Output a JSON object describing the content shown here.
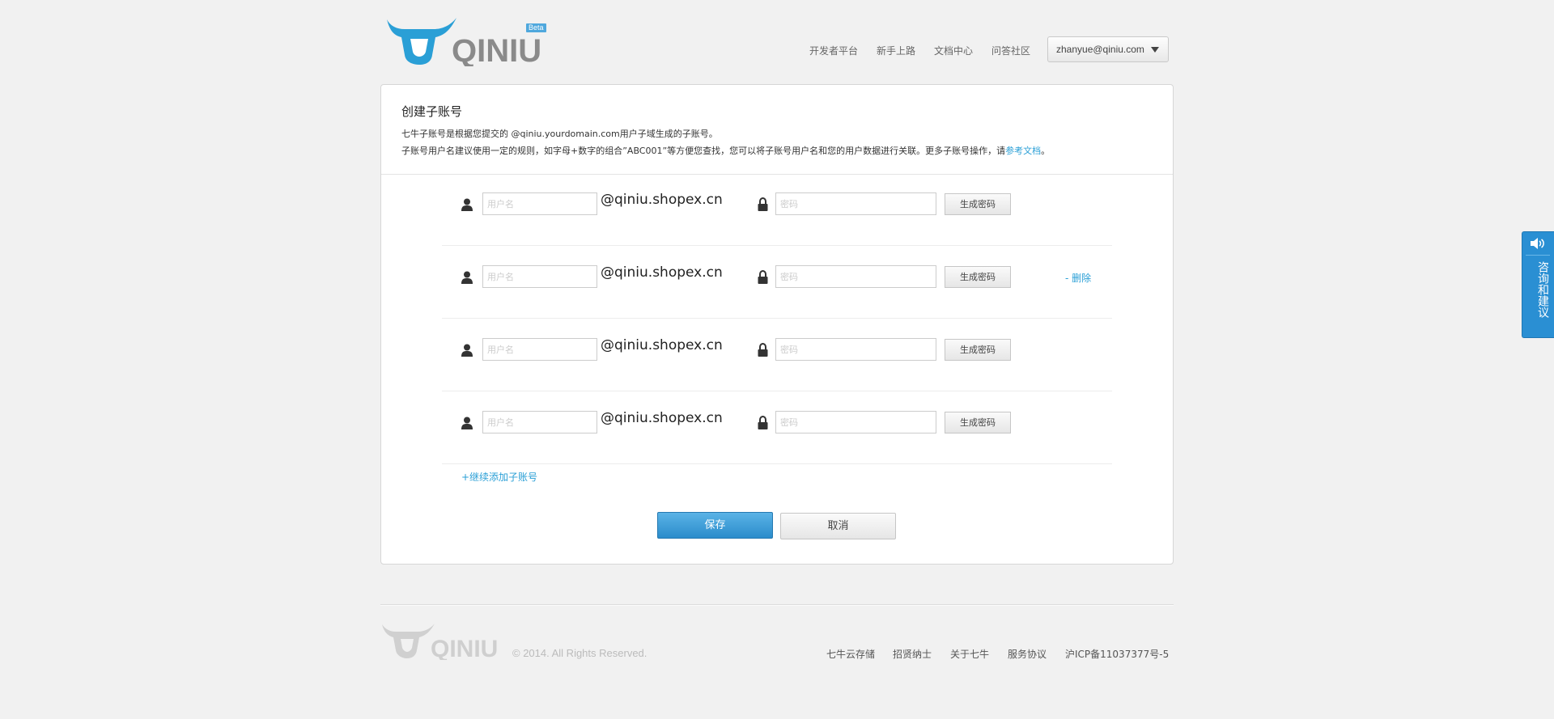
{
  "header": {
    "logo_text": "QINIU",
    "beta_badge": "Beta",
    "nav": [
      "开发者平台",
      "新手上路",
      "文档中心",
      "问答社区"
    ],
    "user_email": "zhanyue@qiniu.com"
  },
  "card": {
    "title": "创建子账号",
    "desc_line1": "七牛子账号是根据您提交的 @qiniu.yourdomain.com用户子域生成的子账号。",
    "desc_line2_prefix": "子账号用户名建议使用一定的规则，如字母+数字的组合”ABC001”等方便您查找，您可以将子账号用户名和您的用户数据进行关联。更多子账号操作，请",
    "desc_line2_link": "参考文档",
    "desc_line2_suffix": "。"
  },
  "rows": [
    {
      "username_placeholder": "用户名",
      "domain": "@qiniu.shopex.cn",
      "password_placeholder": "密码",
      "generate_label": "生成密码",
      "delete_label": ""
    },
    {
      "username_placeholder": "用户名",
      "domain": "@qiniu.shopex.cn",
      "password_placeholder": "密码",
      "generate_label": "生成密码",
      "delete_label": "- 删除"
    },
    {
      "username_placeholder": "用户名",
      "domain": "@qiniu.shopex.cn",
      "password_placeholder": "密码",
      "generate_label": "生成密码",
      "delete_label": ""
    },
    {
      "username_placeholder": "用户名",
      "domain": "@qiniu.shopex.cn",
      "password_placeholder": "密码",
      "generate_label": "生成密码",
      "delete_label": ""
    }
  ],
  "add_more_label": "+继续添加子账号",
  "actions": {
    "save_label": "保存",
    "cancel_label": "取消"
  },
  "footer": {
    "logo_text": "QINIU",
    "copyright": "© 2014. All Rights Reserved.",
    "links": [
      "七牛云存储",
      "招贤纳士",
      "关于七牛",
      "服务协议",
      "沪ICP备11037377号-5"
    ]
  },
  "feedback": {
    "label": "咨询和建议"
  },
  "colors": {
    "accent": "#2a9fd6",
    "primary_button": "#3a9ad9",
    "background": "#f1f1f1"
  },
  "icons": [
    "bull-logo",
    "user-icon",
    "lock-icon",
    "chevron-down-icon",
    "speaker-icon"
  ]
}
